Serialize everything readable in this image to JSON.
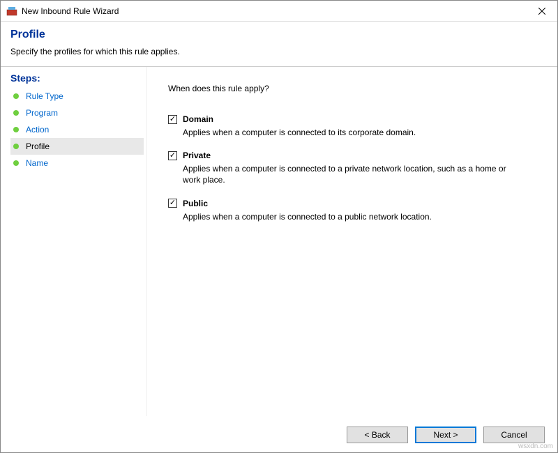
{
  "titlebar": {
    "title": "New Inbound Rule Wizard"
  },
  "header": {
    "page_title": "Profile",
    "subtitle": "Specify the profiles for which this rule applies."
  },
  "sidebar": {
    "heading": "Steps:",
    "items": [
      {
        "label": "Rule Type",
        "current": false
      },
      {
        "label": "Program",
        "current": false
      },
      {
        "label": "Action",
        "current": false
      },
      {
        "label": "Profile",
        "current": true
      },
      {
        "label": "Name",
        "current": false
      }
    ]
  },
  "main": {
    "question": "When does this rule apply?",
    "options": [
      {
        "key": "domain",
        "label": "Domain",
        "checked": true,
        "description": "Applies when a computer is connected to its corporate domain."
      },
      {
        "key": "private",
        "label": "Private",
        "checked": true,
        "description": "Applies when a computer is connected to a private network location, such as a home or work place."
      },
      {
        "key": "public",
        "label": "Public",
        "checked": true,
        "description": "Applies when a computer is connected to a public network location."
      }
    ]
  },
  "footer": {
    "back": "< Back",
    "next": "Next >",
    "cancel": "Cancel"
  },
  "watermark": "wsxdn.com"
}
